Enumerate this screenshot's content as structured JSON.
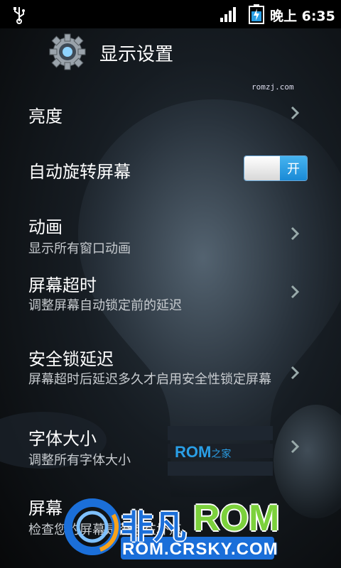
{
  "status_bar": {
    "time": "晚上 6:35",
    "icons": [
      "usb-icon",
      "signal-icon",
      "battery-charging-icon"
    ]
  },
  "header": {
    "title": "显示设置",
    "icon": "settings-gear-icon"
  },
  "watermark_top": "romzj.com",
  "settings": [
    {
      "label": "亮度",
      "summary": ""
    },
    {
      "label": "自动旋转屏幕",
      "summary": "",
      "toggle_text": "开",
      "toggle_on": true
    },
    {
      "label": "动画",
      "summary": "显示所有窗口动画"
    },
    {
      "label": "屏幕超时",
      "summary": "调整屏幕自动锁定前的延迟"
    },
    {
      "label": "安全锁延迟",
      "summary": "屏幕超时后延迟多久才启用安全性锁定屏幕"
    },
    {
      "label": "字体大小",
      "summary": "调整所有字体大小"
    },
    {
      "label": "屏幕",
      "summary": "检查您的屏幕是否存在坏点"
    }
  ],
  "watermarks": {
    "rom_zhijia": "ROM",
    "rom_zhijia_suffix": "之家",
    "feifan": "非凡",
    "feifan_rom": "ROM",
    "url": "ROM.CRSKY.COM"
  },
  "colors": {
    "toggle_on": "#2196e0",
    "feifan_blue": "#1b6fd9",
    "feifan_green": "#7cd13c"
  }
}
